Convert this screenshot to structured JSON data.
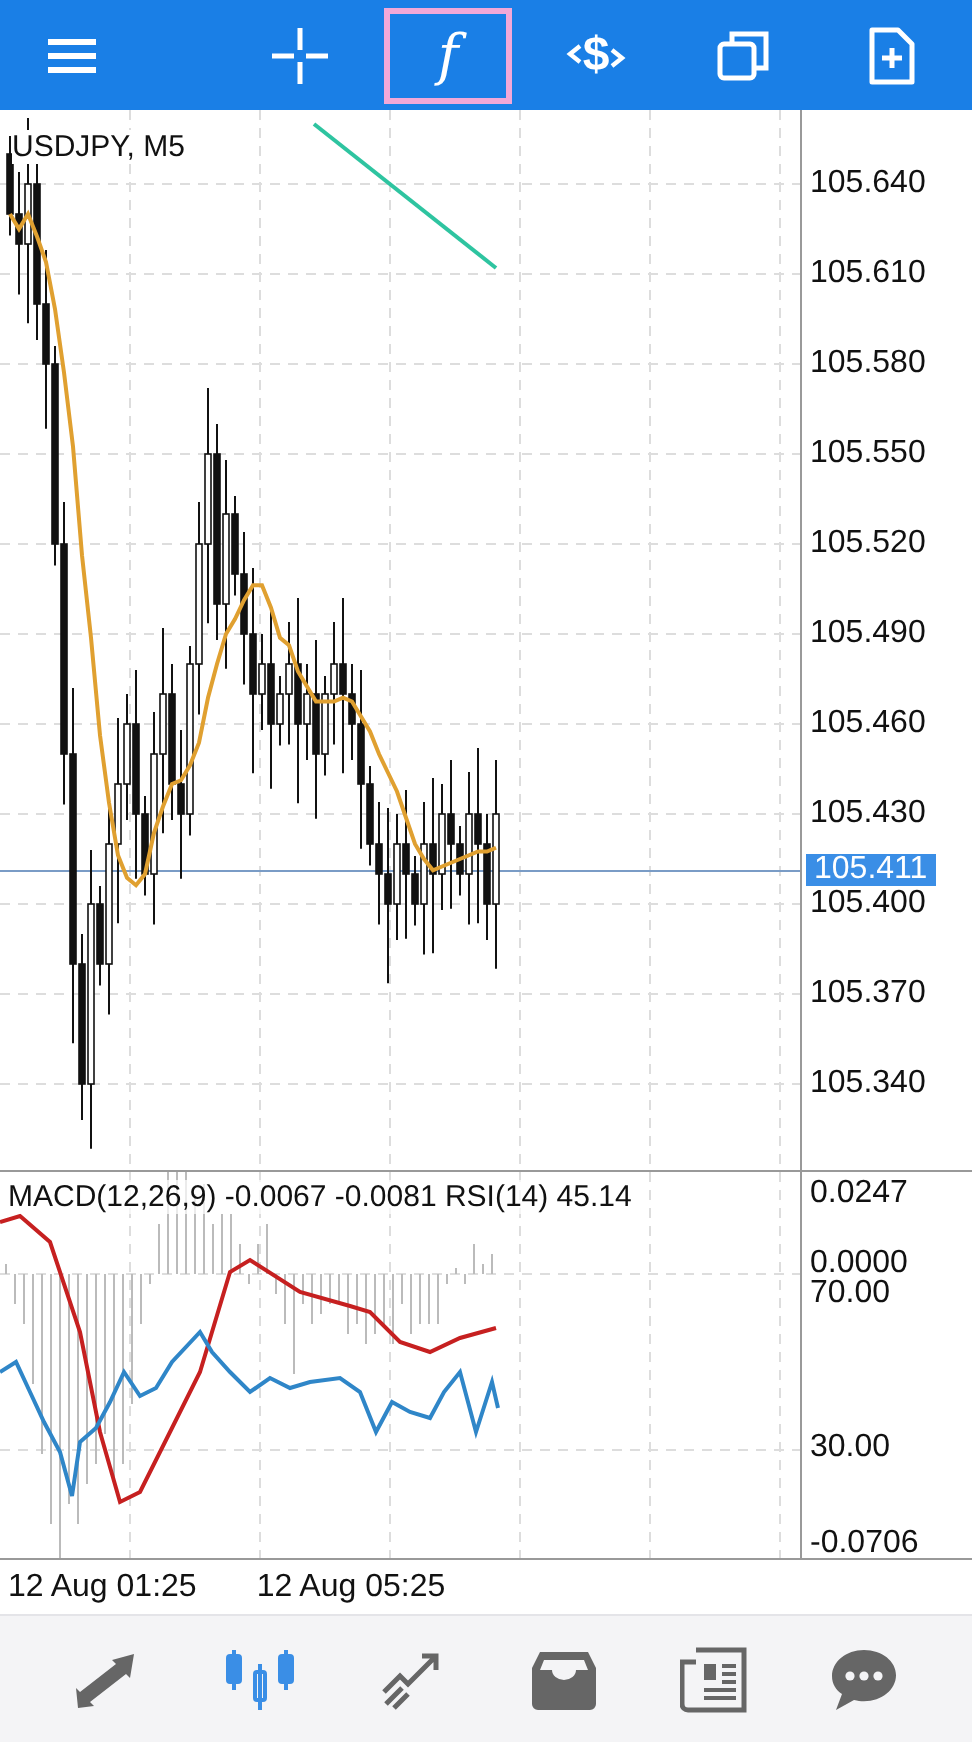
{
  "toolbar": {
    "buttons": [
      {
        "kind": "menu",
        "selected": false
      },
      {
        "kind": "crosshair",
        "selected": false
      },
      {
        "kind": "function",
        "label": "f",
        "selected": true
      },
      {
        "kind": "currency",
        "label": "$",
        "selected": false
      },
      {
        "kind": "windows",
        "selected": false
      },
      {
        "kind": "new-file",
        "selected": false
      }
    ]
  },
  "main_chart": {
    "title": "USDJPY, M5",
    "price_labels": [
      "105.640",
      "105.610",
      "105.580",
      "105.550",
      "105.520",
      "105.490",
      "105.460",
      "105.430",
      "105.400",
      "105.370",
      "105.340"
    ],
    "current_price": "105.411"
  },
  "indicator": {
    "title": "MACD(12,26,9) -0.0067 -0.0081 RSI(14) 45.14",
    "labels": [
      {
        "kind": "top",
        "text": "0.0247"
      },
      {
        "kind": "upper",
        "text": "0.0000"
      },
      {
        "kind": "upper-low",
        "text": "70.00"
      },
      {
        "kind": "lower",
        "text": "30.00"
      },
      {
        "kind": "bottom",
        "text": "-0.0706"
      }
    ]
  },
  "time_labels": [
    "12 Aug 01:25",
    "12 Aug 05:25"
  ],
  "bottom_nav": [
    {
      "kind": "trade",
      "selected": false
    },
    {
      "kind": "chart",
      "selected": true
    },
    {
      "kind": "history",
      "selected": false
    },
    {
      "kind": "inbox",
      "selected": false
    },
    {
      "kind": "news",
      "selected": false
    },
    {
      "kind": "chat",
      "selected": false
    }
  ]
}
